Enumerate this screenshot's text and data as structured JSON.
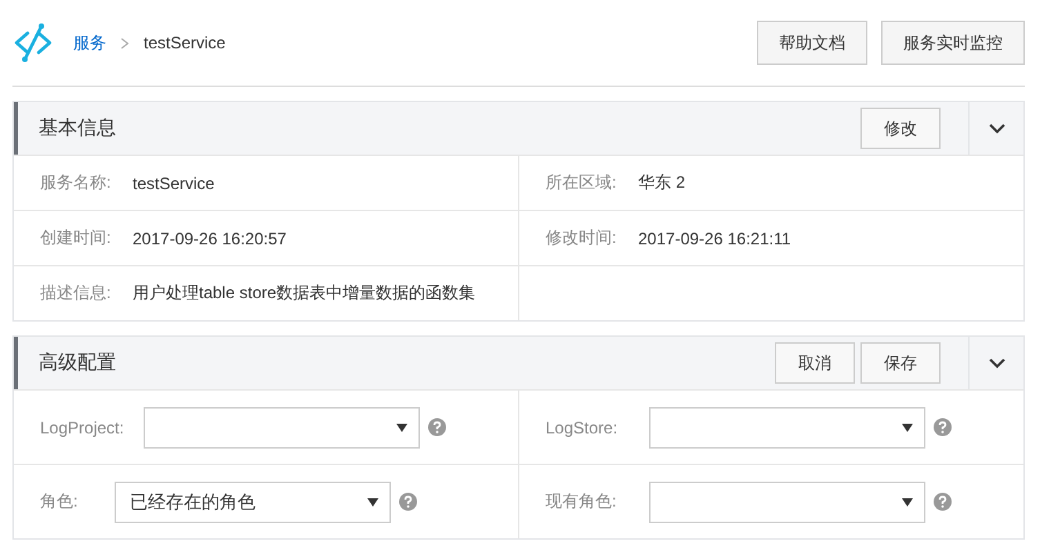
{
  "breadcrumb": [
    {
      "label": "服务",
      "link": true
    },
    {
      "label": "testService",
      "link": false
    }
  ],
  "header_buttons": [
    "帮助文档",
    "服务实时监控"
  ],
  "basic_info": {
    "title": "基本信息",
    "buttons": [
      "修改"
    ],
    "expanded": true,
    "rows": [
      [
        {
          "label": "服务名称:",
          "value": "testService"
        },
        {
          "label": "所在区域:",
          "value": "华东 2"
        }
      ],
      [
        {
          "label": "创建时间:",
          "value": "2017-09-26 16:20:57"
        },
        {
          "label": "修改时间:",
          "value": "2017-09-26 16:21:11"
        }
      ],
      [
        {
          "label": "描述信息:",
          "value": "用户处理table store数据表中增量数据的函数集"
        }
      ]
    ]
  },
  "advanced": {
    "title": "高级配置",
    "buttons": [
      "取消",
      "保存"
    ],
    "expanded": true,
    "rows": [
      [
        {
          "label": "LogProject:"
        },
        {
          "label": "LogStore:"
        }
      ],
      [
        {
          "label": "角色:",
          "value": "已经存在的角色"
        },
        {
          "label": "现有角色:"
        }
      ]
    ]
  }
}
